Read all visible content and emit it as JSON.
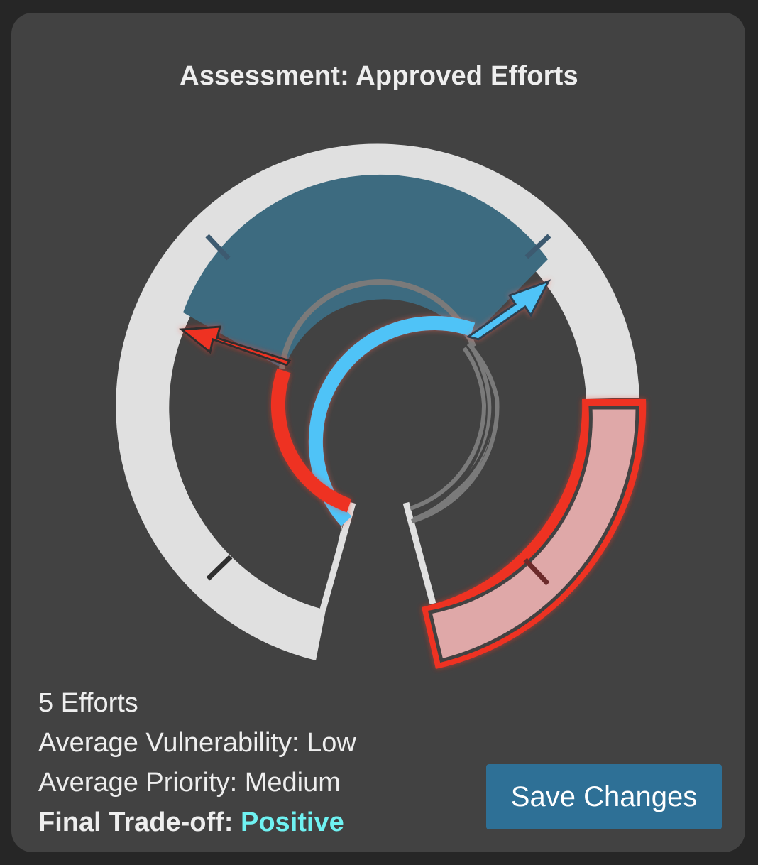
{
  "title": "Assessment: Approved Efforts",
  "gauge": {
    "colors": {
      "track": "#e0e0e0",
      "approved_zone": "#3d6b80",
      "risk_zone": "#dfa8a8",
      "risk_outline": "#ee3322",
      "positive_arc": "#4fc3f7",
      "negative_arc": "#ee3322",
      "inner_ring": "#7a7a7a",
      "tick": "#3d5a70",
      "risk_tick": "#6b2a2a"
    },
    "icons": {
      "positive": "arrow-up-right-icon",
      "negative": "arrow-left-icon"
    }
  },
  "stats": {
    "efforts": "5 Efforts",
    "vulnerability": "Average Vulnerability: Low",
    "priority": "Average Priority: Medium",
    "tradeoff_label": "Final Trade-off: ",
    "tradeoff_value": "Positive"
  },
  "save_button": {
    "label": "Save Changes"
  }
}
